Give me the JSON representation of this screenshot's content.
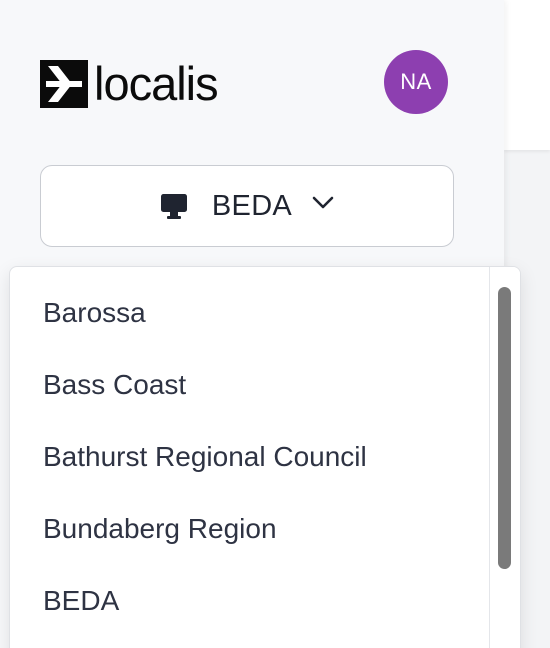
{
  "app": {
    "logo_text": "localis"
  },
  "user": {
    "initials": "NA",
    "avatar_color": "#8d3fb0"
  },
  "council_selector": {
    "icon": "monitor-icon",
    "selected": "BEDA",
    "chevron": "chevron-down-icon"
  },
  "dropdown": {
    "items": [
      {
        "label": "Barossa"
      },
      {
        "label": "Bass Coast"
      },
      {
        "label": "Bathurst Regional Council"
      },
      {
        "label": "Bundaberg Region"
      },
      {
        "label": "BEDA"
      }
    ]
  }
}
